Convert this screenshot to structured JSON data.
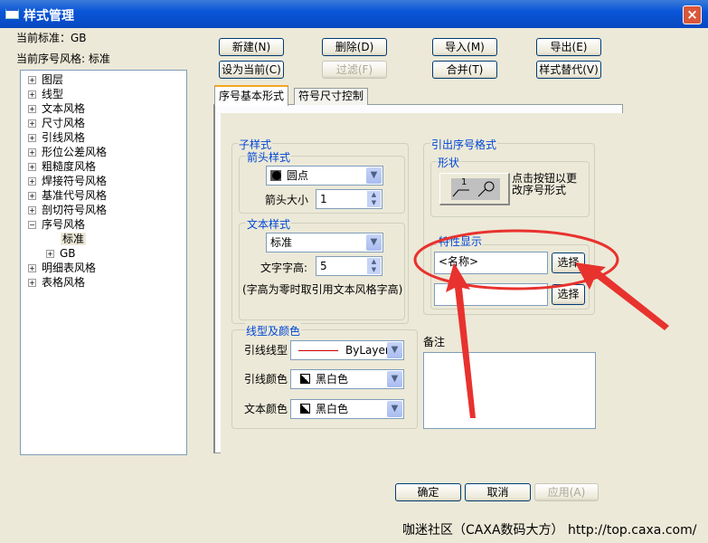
{
  "window": {
    "title": "样式管理",
    "close": "×"
  },
  "header": {
    "current_standard": "当前标准：GB",
    "current_style": "当前序号风格: 标准"
  },
  "tree": {
    "items": [
      {
        "label": "图层",
        "sign": "+"
      },
      {
        "label": "线型",
        "sign": "+"
      },
      {
        "label": "文本风格",
        "sign": "+"
      },
      {
        "label": "尺寸风格",
        "sign": "+"
      },
      {
        "label": "引线风格",
        "sign": "+"
      },
      {
        "label": "形位公差风格",
        "sign": "+"
      },
      {
        "label": "粗糙度风格",
        "sign": "+"
      },
      {
        "label": "焊接符号风格",
        "sign": "+"
      },
      {
        "label": "基准代号风格",
        "sign": "+"
      },
      {
        "label": "剖切符号风格",
        "sign": "+"
      },
      {
        "label": "序号风格",
        "sign": "−"
      }
    ],
    "child_selected": "标准",
    "child_gb": "GB",
    "after": [
      {
        "label": "明细表风格",
        "sign": "+"
      },
      {
        "label": "表格风格",
        "sign": "+"
      }
    ]
  },
  "toolbar": {
    "new": "新建(N)",
    "delete": "删除(D)",
    "import": "导入(M)",
    "export": "导出(E)",
    "set_current": "设为当前(C)",
    "filter": "过滤(F)",
    "merge": "合并(T)",
    "replace": "样式替代(V)"
  },
  "tabs": [
    "序号基本形式",
    "符号尺寸控制"
  ],
  "sub_style": {
    "title": "子样式",
    "arrow_group": "箭头样式",
    "arrow_value": "圆点",
    "arrow_size_label": "箭头大小",
    "arrow_size": "1",
    "text_group": "文本样式",
    "text_value": "标准",
    "text_height_label": "文字字高:",
    "text_height": "5",
    "note": "(字高为零时取引用文本风格字高)"
  },
  "line_color": {
    "title": "线型及颜色",
    "line_type_label": "引线线型",
    "line_type": "ByLayer",
    "line_color_label": "引线颜色",
    "line_color": "黑白色",
    "text_color_label": "文本颜色",
    "text_color": "黑白色"
  },
  "format": {
    "title": "引出序号格式",
    "shape_group": "形状",
    "shape_hint": "点击按钮以更改序号形式",
    "shape_num": "1",
    "shape_circ": "①",
    "prop_group": "特性显示",
    "prop1": "<名称>",
    "prop2": "",
    "select": "选择",
    "remark_label": "备注",
    "remark": ""
  },
  "footer": {
    "ok": "确定",
    "cancel": "取消",
    "apply": "应用(A)",
    "watermark": "咖迷社区（CAXA数码大方） http://top.caxa.com/"
  },
  "colors": {
    "annotation": "#e8322e",
    "title_bar": "#0a56d8"
  }
}
